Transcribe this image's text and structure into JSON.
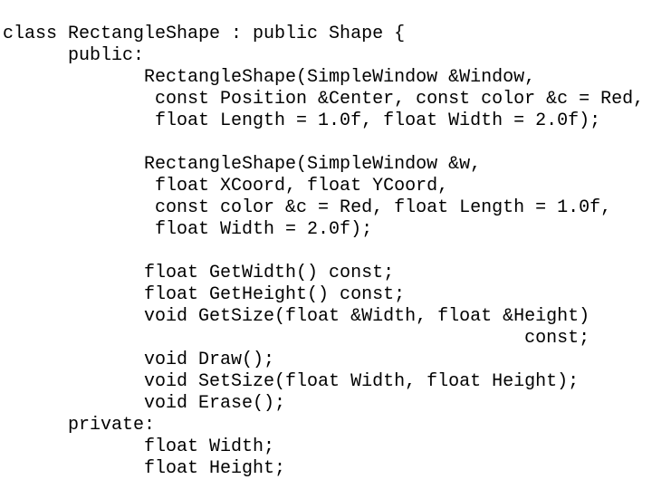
{
  "slide": {
    "kind": "code-listing-slide",
    "language": "C++",
    "subject": "RectangleShape class declaration",
    "background_color": "#ffffff",
    "text_color": "#000000",
    "font_style": "monospace"
  },
  "code": {
    "lines": [
      "class RectangleShape : public Shape {",
      "      public:",
      "             RectangleShape(SimpleWindow &Window,",
      "              const Position &Center, const color &c = Red,",
      "              float Length = 1.0f, float Width = 2.0f);",
      "",
      "             RectangleShape(SimpleWindow &w,",
      "              float XCoord, float YCoord,",
      "              const color &c = Red, float Length = 1.0f,",
      "              float Width = 2.0f);",
      "",
      "             float GetWidth() const;",
      "             float GetHeight() const;",
      "             void GetSize(float &Width, float &Height)",
      "                                                const;",
      "             void Draw();",
      "             void SetSize(float Width, float Height);",
      "             void Erase();",
      "      private:",
      "             float Width;",
      "             float Height;"
    ]
  }
}
